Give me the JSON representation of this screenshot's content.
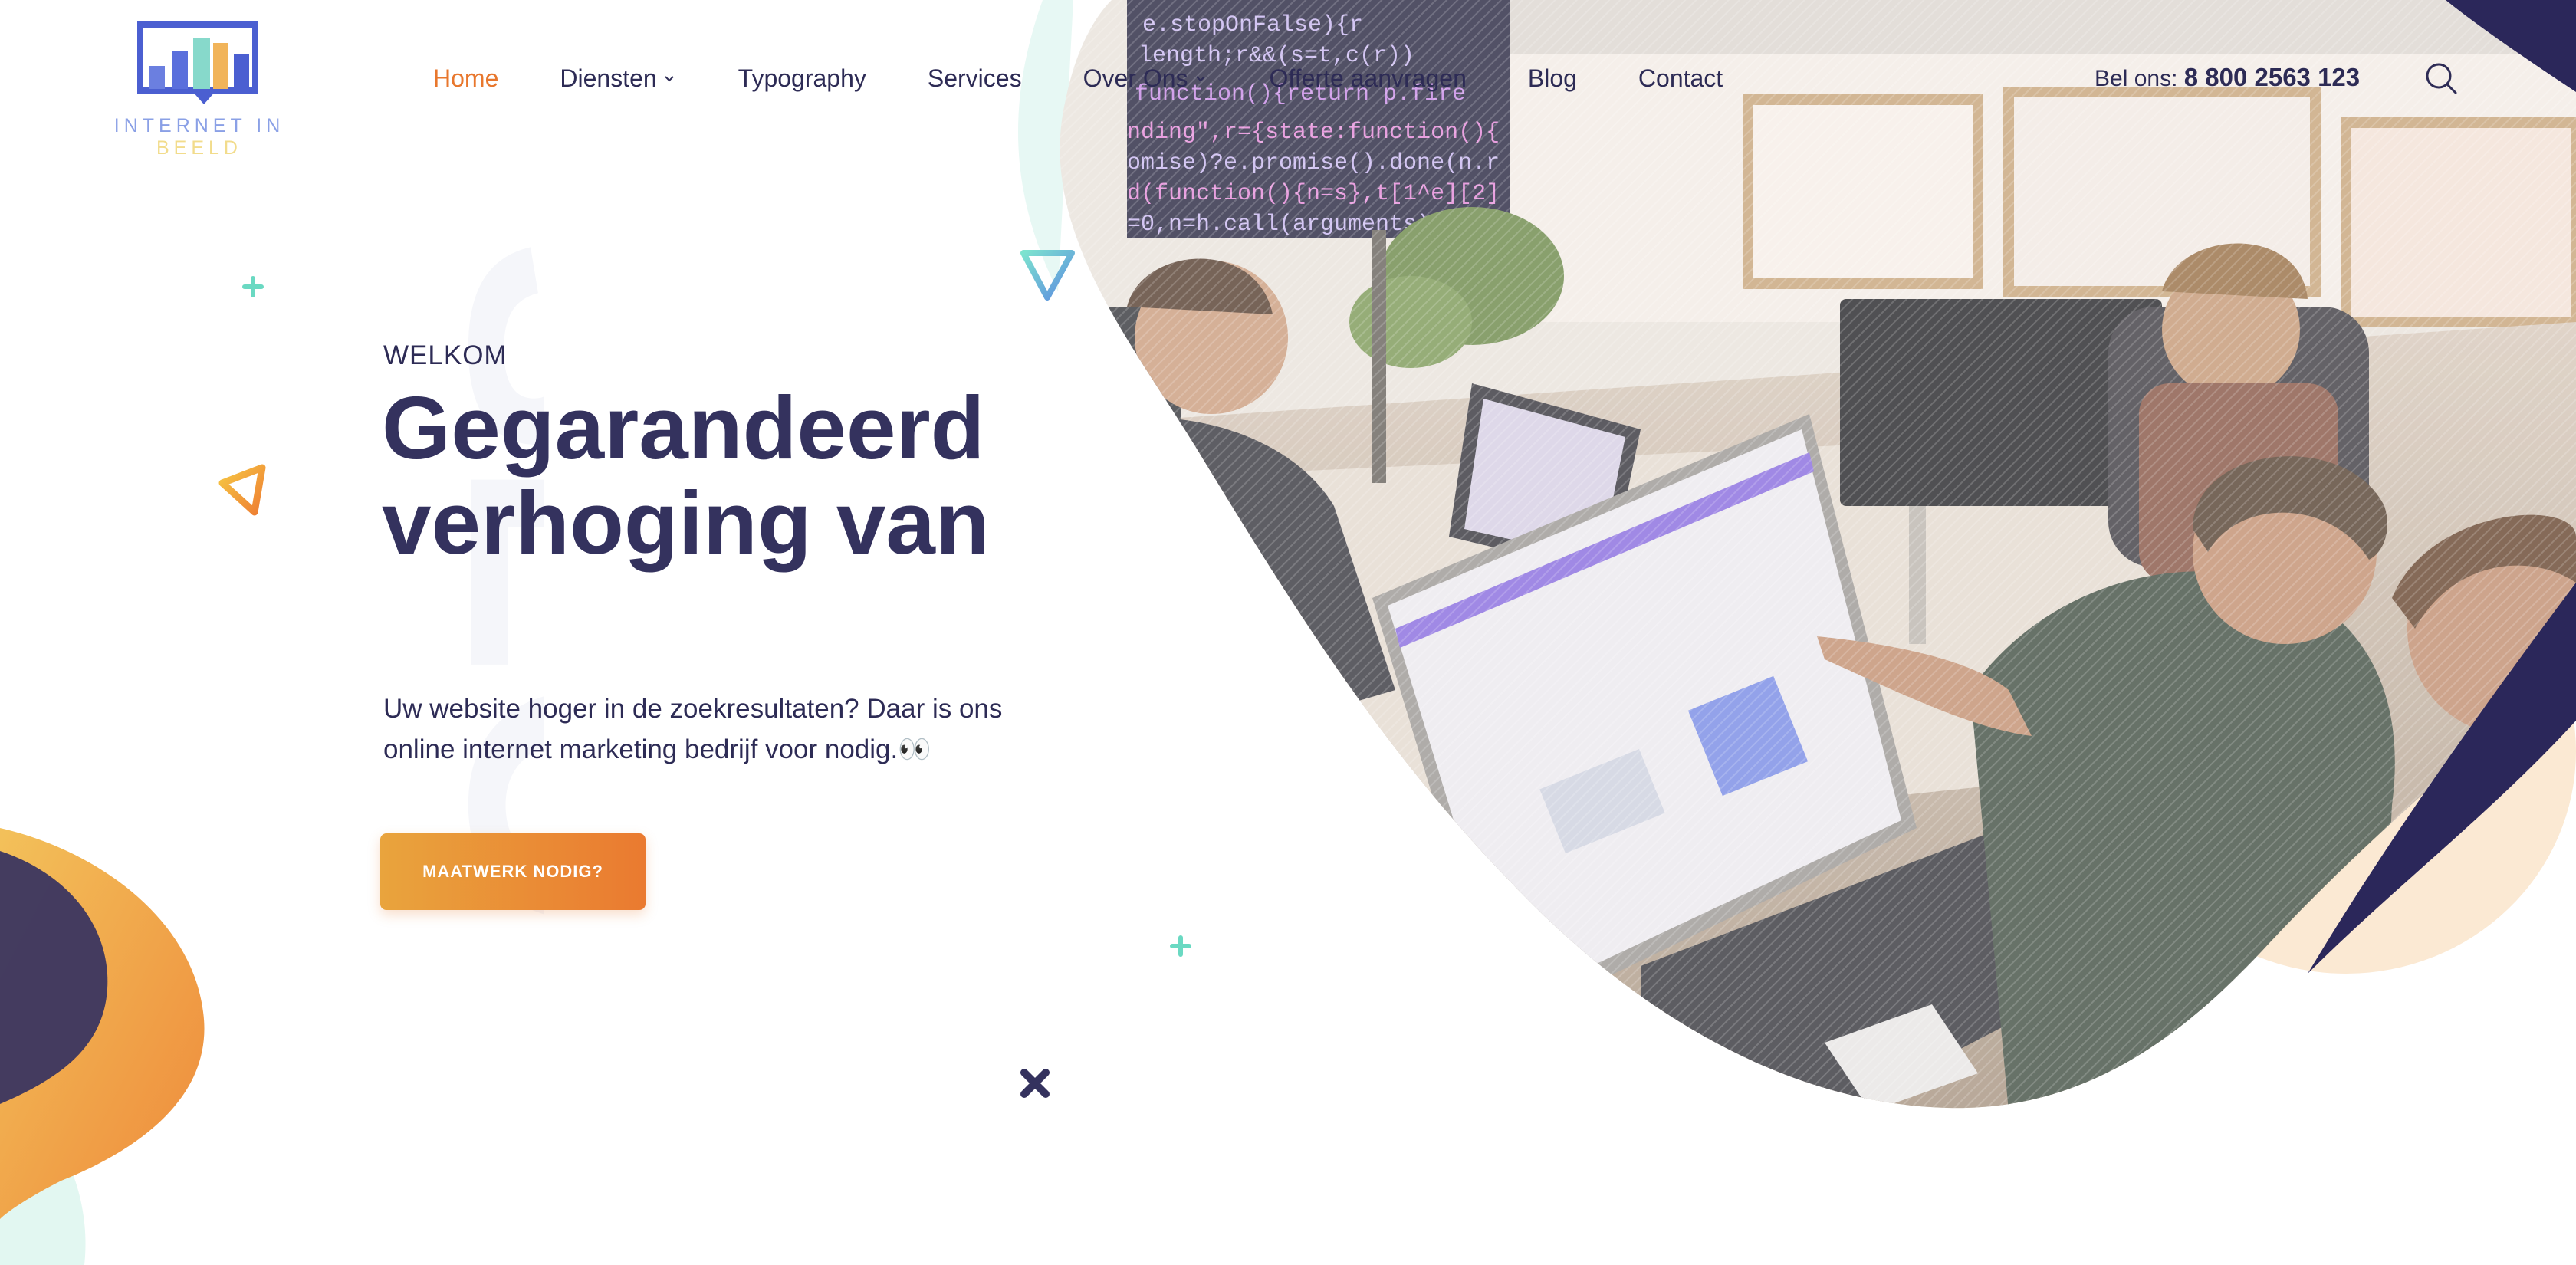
{
  "brand": {
    "logo_word1": "INTERNET IN",
    "logo_word2": "BEELD"
  },
  "nav": {
    "items": [
      {
        "label": "Home",
        "active": true
      },
      {
        "label": "Diensten",
        "dropdown": true
      },
      {
        "label": "Typography"
      },
      {
        "label": "Services"
      },
      {
        "label": "Over Ons",
        "dropdown": true
      },
      {
        "label": "Offerte aanvragen"
      },
      {
        "label": "Blog"
      },
      {
        "label": "Contact"
      }
    ]
  },
  "contact": {
    "phone_prefix": "Bel ons:",
    "phone_number": "8 800 2563 123"
  },
  "hero": {
    "eyebrow": "WELKOM",
    "title_line1": "Gegarandeerd",
    "title_line2": "verhoging van",
    "watermark": "SEO",
    "description_line1": "Uw website hoger in de zoekresultaten? Daar is ons",
    "description_line2": "online internet marketing bedrijf voor nodig.👀",
    "cta_label": "MAATWERK NODIG?"
  },
  "icons": {
    "search": "search-icon",
    "chevron": "chevron-down-icon"
  },
  "colors": {
    "accent": "#e8772d",
    "navy": "#34325e",
    "teal": "#5fd6c0",
    "orange": "#f0a53a"
  }
}
